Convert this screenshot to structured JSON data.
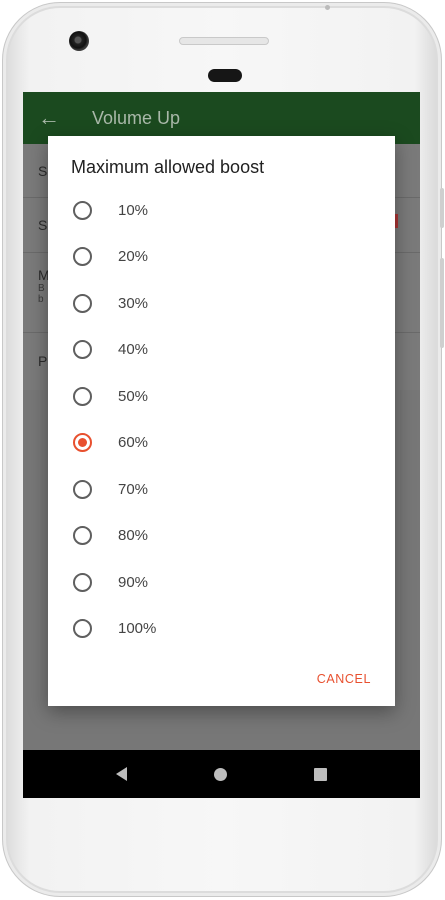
{
  "app": {
    "title": "Volume Up",
    "back_icon": "arrow-left-icon"
  },
  "background_settings": [
    {
      "label": "S"
    },
    {
      "label": "S"
    },
    {
      "label": "M",
      "sub1": "B",
      "sub2": "b"
    },
    {
      "label": "P"
    }
  ],
  "dialog": {
    "title": "Maximum allowed boost",
    "options": [
      {
        "label": "10%",
        "checked": false
      },
      {
        "label": "20%",
        "checked": false
      },
      {
        "label": "30%",
        "checked": false
      },
      {
        "label": "40%",
        "checked": false
      },
      {
        "label": "50%",
        "checked": false
      },
      {
        "label": "60%",
        "checked": true
      },
      {
        "label": "70%",
        "checked": false
      },
      {
        "label": "80%",
        "checked": false
      },
      {
        "label": "90%",
        "checked": false
      },
      {
        "label": "100%",
        "checked": false
      }
    ],
    "cancel_label": "CANCEL",
    "accent_color": "#e8502f"
  },
  "colors": {
    "appbar": "#1b4a1f",
    "scrim": "#777777"
  },
  "navigation": {
    "back": "nav-back-icon",
    "home": "nav-home-icon",
    "recents": "nav-recents-icon"
  }
}
